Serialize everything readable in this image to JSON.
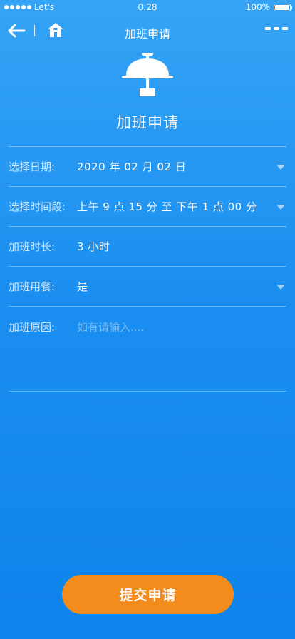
{
  "status_bar": {
    "carrier": "Let's",
    "time": "0:28",
    "battery_text": "100%",
    "battery_level": 1.0
  },
  "nav": {
    "title": "加班申请",
    "back_icon": "back-arrow-icon",
    "home_icon": "home-icon",
    "more_icon": "more-dots-icon"
  },
  "hero": {
    "icon": "service-bell-icon",
    "title": "加班申请"
  },
  "form": {
    "date": {
      "label": "选择日期:",
      "value": "2020 年 02 月 02 日"
    },
    "time_range": {
      "label": "选择时间段:",
      "value": "上午 9 点 15 分  至  下午 1 点 00 分"
    },
    "duration": {
      "label": "加班时长:",
      "value": "3 小时"
    },
    "meal": {
      "label": "加班用餐:",
      "value": "是"
    },
    "reason": {
      "label": "加班原因:",
      "value": "",
      "placeholder": "如有请输入...."
    }
  },
  "submit": {
    "label": "提交申请"
  },
  "colors": {
    "background_top": "#35a4f6",
    "background_bottom": "#0e83ec",
    "accent_button": "#f48b1d",
    "text": "#ffffff"
  }
}
